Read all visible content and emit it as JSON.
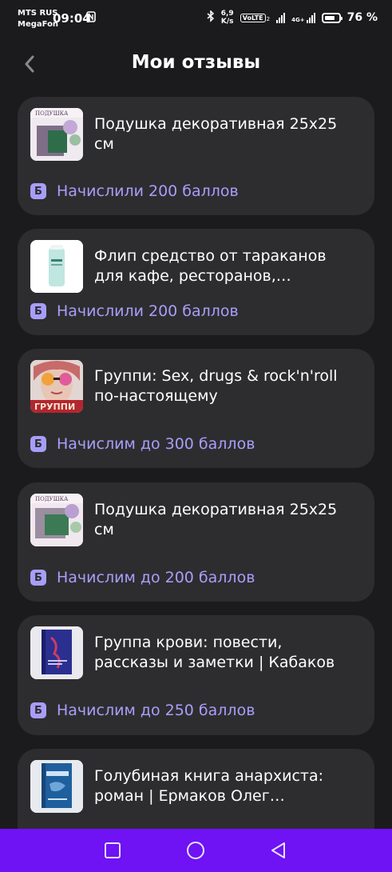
{
  "status": {
    "carrier_line1": "MTS RUS",
    "carrier_line2": "MegaFon",
    "time": "09:04",
    "nfc_icon": "nfc-icon",
    "speed_value": "6,9",
    "speed_unit": "K/s",
    "volte": "VoLTE",
    "volte_sub": "2",
    "network": "4G+",
    "battery_level": 0.76,
    "battery_percent": "76 %"
  },
  "header": {
    "title": "Мои отзывы"
  },
  "reviews": [
    {
      "name": "Подушка декоративная 25х25 см",
      "reward": "Начислили 200 баллов",
      "badge": "Б"
    },
    {
      "name": "Флип средство от тараканов для кафе, ресторанов, общежитий",
      "reward": "Начислили 200 баллов",
      "badge": "Б"
    },
    {
      "name": "Группи: Sex, drugs & rock'n'roll по-настоящему",
      "reward": "Начислим до 300 баллов",
      "badge": "Б"
    },
    {
      "name": "Подушка декоративная 25х25 см",
      "reward": "Начислим до 200 баллов",
      "badge": "Б"
    },
    {
      "name": "Группа крови: повести, рассказы и заметки | Кабаков",
      "reward": "Начислим до 250 баллов",
      "badge": "Б"
    },
    {
      "name": "Голубиная книга анархиста: роман | Ермаков Олег Николаевич",
      "reward": "",
      "badge": ""
    }
  ],
  "colors": {
    "background": "#1b1b1d",
    "card": "#2d2d30",
    "accent": "#a79ef8",
    "nav_bar": "#6f12f4"
  }
}
